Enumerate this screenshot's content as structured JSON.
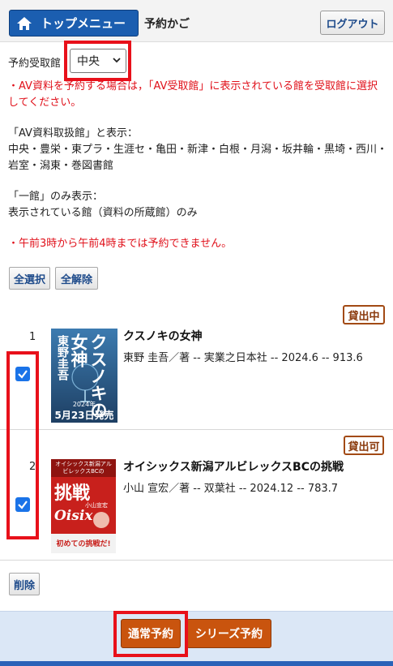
{
  "header": {
    "top_menu_label": "トップメニュー",
    "page_title": "予約かご",
    "logout_label": "ログアウト"
  },
  "pickup": {
    "label": "予約受取館",
    "selected": "中央"
  },
  "notices": {
    "av_notice": "・AV資料を予約する場合は，「AV受取館」に表示されている館を受取館に選択してください。",
    "av_heading": "「AV資料取扱館」と表示：",
    "av_libraries": "中央・豊栄・東プラ・生涯セ・亀田・新津・白根・月潟・坂井輪・黒埼・西川・岩室・潟東・巻図書館",
    "single_heading": "「一館」のみ表示：",
    "single_desc": "表示されている館（資料の所蔵館）のみ",
    "time_notice": "・午前3時から午前4時までは予約できません。"
  },
  "actions": {
    "select_all": "全選択",
    "deselect_all": "全解除",
    "delete": "削除"
  },
  "items": [
    {
      "number": "1",
      "status": "貸出中",
      "title": "クスノキの女神",
      "meta": "東野 圭吾／著 -- 実業之日本社 -- 2024.6 -- 913.6",
      "cover": {
        "title_vertical": "クスノキの女神",
        "author_vertical": "東野圭吾",
        "year_text": "2024年",
        "release_text": "5月23日発売"
      }
    },
    {
      "number": "2",
      "status": "貸出可",
      "title": "オイシックス新潟アルビレックスBCの挑戦",
      "meta": "小山 宣宏／著 -- 双葉社 -- 2024.12 -- 783.7",
      "cover": {
        "top_text": "オイシックス新潟アルビレックスBCの",
        "big_text": "挑戦",
        "author_text": "小山宣宏",
        "logo_text": "Oisix",
        "bottom_text": "初めての挑戦だ!"
      }
    }
  ],
  "footer": {
    "normal_reserve": "通常予約",
    "series_reserve": "シリーズ予約"
  },
  "colors": {
    "header_button": "#1b5eb0",
    "highlight": "#e8101a",
    "reserve_button": "#c9540e",
    "footer_bg": "#dbe7f6"
  }
}
